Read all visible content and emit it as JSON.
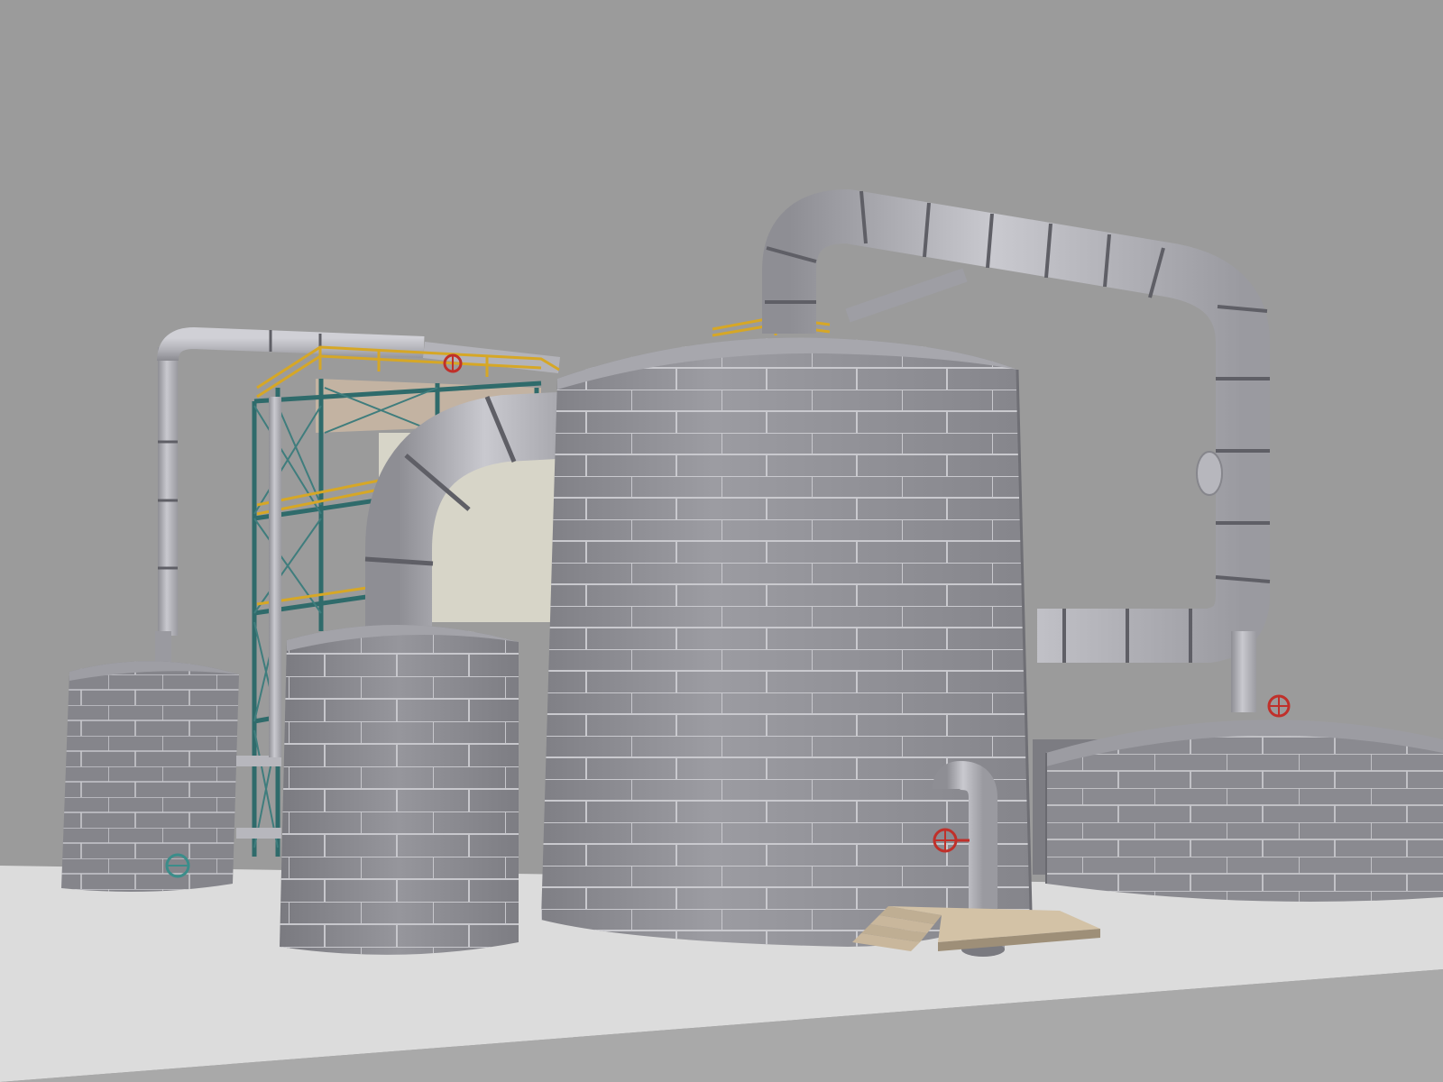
{
  "scene": {
    "subject": "industrial-tank-facility-render",
    "colors": {
      "sky": "#9b9b9b",
      "ground": "#dcdcdc",
      "ground_shadow": "#c9c9c9",
      "tank": "#8d8d93",
      "tank_light": "#9e9ea4",
      "tank_dark": "#6f6f75",
      "tank_seam": "#cfcfd4",
      "pipe": "#b7b7bd",
      "pipe_dark": "#86868c",
      "pipe_band": "#5f5f66",
      "frame": "#2f6b6b",
      "railing": "#d6a726",
      "valve": "#c0302a",
      "valve_teal": "#3b8d8a",
      "stairs": "#c9b79c",
      "building": "#d7d5c8"
    }
  }
}
